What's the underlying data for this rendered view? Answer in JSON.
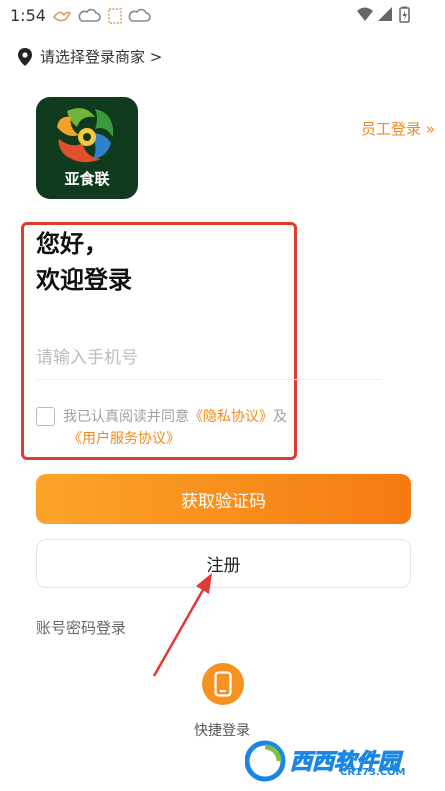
{
  "status_bar": {
    "time": "1:54"
  },
  "merchant": {
    "label": "请选择登录商家 >"
  },
  "logo": {
    "brand_text": "亚食联"
  },
  "staff_login": {
    "label": "员工登录 »"
  },
  "greeting": {
    "line1": "您好，",
    "line2": "欢迎登录"
  },
  "phone_input": {
    "placeholder": "请输入手机号",
    "value": ""
  },
  "agreement": {
    "prefix": "我已认真阅读并同意",
    "privacy": "《隐私协议》",
    "and": "及",
    "service": "《用户服务协议》"
  },
  "buttons": {
    "get_code": "获取验证码",
    "register": "注册"
  },
  "password_login": {
    "label": "账号密码登录"
  },
  "quick_login": {
    "label": "快捷登录"
  },
  "watermark": {
    "text": "西西软件园",
    "sub": "CR173.COM"
  },
  "colors": {
    "accent": "#f08a1c",
    "highlight_border": "#e03a35",
    "annotation_arrow": "#e03a35"
  }
}
